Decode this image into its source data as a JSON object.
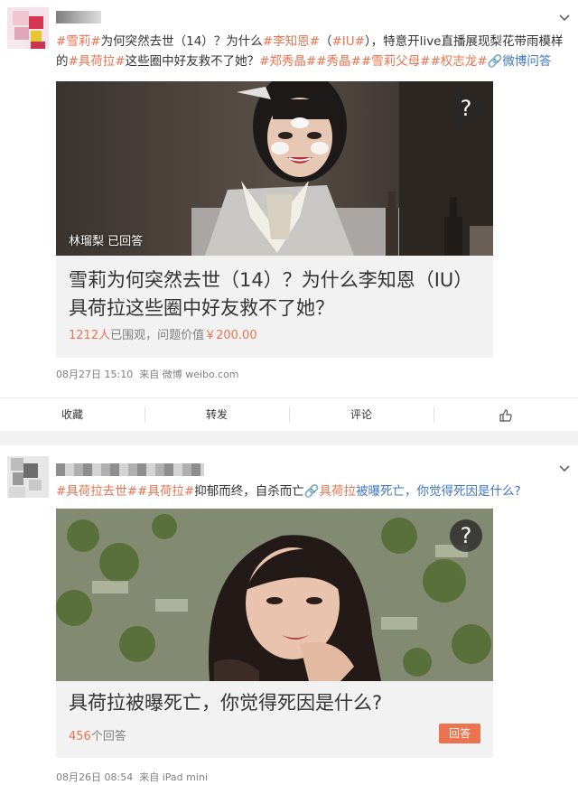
{
  "post1": {
    "text": {
      "t1": "#雪莉#",
      "t2": "为何突然去世（14）？为什么",
      "t3": "#李知恩#",
      "t4": "（",
      "t5": "#IU#",
      "t6": "），特意开live直播展现梨花带雨模样的",
      "t7": "#具荷拉#",
      "t8": "这些圈中好友救不了她？",
      "t9": "#郑秀晶##秀晶##雪莉父母##权志龙#",
      "t10": "🔗微博问答"
    },
    "card": {
      "answered_label": "林瑠梨 已回答",
      "qmark": "?",
      "title": "雪莉为何突然去世（14）？为什么李知恩（IU）具荷拉这些圈中好友救不了她？",
      "viewers_count": "1212人",
      "viewers_suffix": "已围观，问题价值",
      "price": "￥200.00"
    },
    "time": "08月27日 15:10",
    "source": "来自 微博 weibo.com"
  },
  "actions": {
    "favorite": "收藏",
    "repost": "转发",
    "comment": "评论"
  },
  "post2": {
    "text": {
      "t1": "#具荷拉去世##具荷拉#",
      "t2": "抑郁而终，自杀而亡",
      "t3": "🔗具荷拉",
      "t4": "被曝死亡，你觉得死因是什么?"
    },
    "card": {
      "qmark": "?",
      "title": "具荷拉被曝死亡，你觉得死因是什么?",
      "answers_count": "456",
      "answers_suffix": "个回答",
      "reply_button": "回答"
    },
    "time": "08月26日 08:54",
    "source": "来自 iPad mini"
  },
  "colors": {
    "topic": "#eb7350",
    "link": "#3f76c4",
    "meta": "#808080",
    "button": "#eb7350"
  }
}
